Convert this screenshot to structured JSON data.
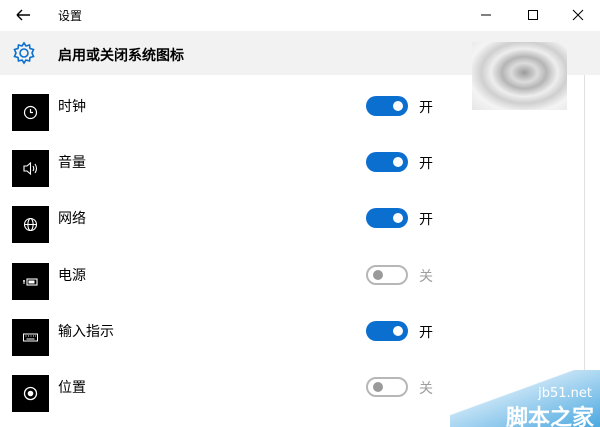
{
  "window": {
    "title": "设置",
    "back_icon": "back-arrow-icon",
    "minimize_icon": "minimize-icon",
    "maximize_icon": "maximize-icon",
    "close_icon": "close-icon"
  },
  "header": {
    "title": "启用或关闭系统图标",
    "icon": "gear-icon"
  },
  "colors": {
    "accent": "#0a6fcf",
    "header_bg": "#f2f2f2",
    "toggle_off_border": "#b7b7b7",
    "state_off_text": "#9e9e9e"
  },
  "items": [
    {
      "label": "时钟",
      "icon": "clock-icon",
      "on": true,
      "state": "开"
    },
    {
      "label": "音量",
      "icon": "volume-icon",
      "on": true,
      "state": "开"
    },
    {
      "label": "网络",
      "icon": "globe-icon",
      "on": true,
      "state": "开"
    },
    {
      "label": "电源",
      "icon": "battery-icon",
      "on": false,
      "state": "关"
    },
    {
      "label": "输入指示",
      "icon": "keyboard-icon",
      "on": true,
      "state": "开"
    },
    {
      "label": "位置",
      "icon": "location-icon",
      "on": false,
      "state": "关"
    }
  ],
  "watermark": {
    "url": "jb51.net",
    "site": "脚本之家"
  }
}
